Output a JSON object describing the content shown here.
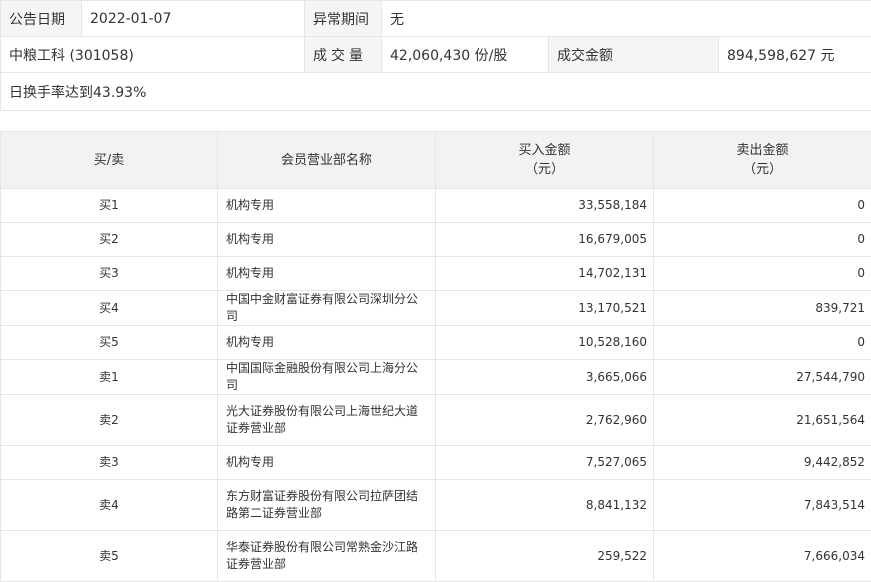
{
  "info": {
    "announce_date_label": "公告日期",
    "announce_date": "2022-01-07",
    "abnormal_period_label": "异常期间",
    "abnormal_period": "无",
    "stock": "中粮工科 (301058)",
    "volume_label": "成交量",
    "volume": "42,060,430 份/股",
    "amount_label": "成交金额",
    "amount": "894,598,627 元",
    "note": "日换手率达到43.93%"
  },
  "table": {
    "headers": {
      "side": "买/卖",
      "dept": "会员营业部名称",
      "buy_line1": "买入金额",
      "buy_line2": "（元）",
      "sell_line1": "卖出金额",
      "sell_line2": "（元）"
    },
    "rows": [
      {
        "side": "买1",
        "dept": "机构专用",
        "buy": "33,558,184",
        "sell": "0"
      },
      {
        "side": "买2",
        "dept": "机构专用",
        "buy": "16,679,005",
        "sell": "0"
      },
      {
        "side": "买3",
        "dept": "机构专用",
        "buy": "14,702,131",
        "sell": "0"
      },
      {
        "side": "买4",
        "dept": "中国中金财富证券有限公司深圳分公司",
        "buy": "13,170,521",
        "sell": "839,721"
      },
      {
        "side": "买5",
        "dept": "机构专用",
        "buy": "10,528,160",
        "sell": "0"
      },
      {
        "side": "卖1",
        "dept": "中国国际金融股份有限公司上海分公司",
        "buy": "3,665,066",
        "sell": "27,544,790"
      },
      {
        "side": "卖2",
        "dept": "光大证券股份有限公司上海世纪大道证券营业部",
        "buy": "2,762,960",
        "sell": "21,651,564"
      },
      {
        "side": "卖3",
        "dept": "机构专用",
        "buy": "7,527,065",
        "sell": "9,442,852"
      },
      {
        "side": "卖4",
        "dept": "东方财富证券股份有限公司拉萨团结路第二证券营业部",
        "buy": "8,841,132",
        "sell": "7,843,514"
      },
      {
        "side": "卖5",
        "dept": "华泰证券股份有限公司常熟金沙江路证券营业部",
        "buy": "259,522",
        "sell": "7,666,034"
      }
    ]
  }
}
